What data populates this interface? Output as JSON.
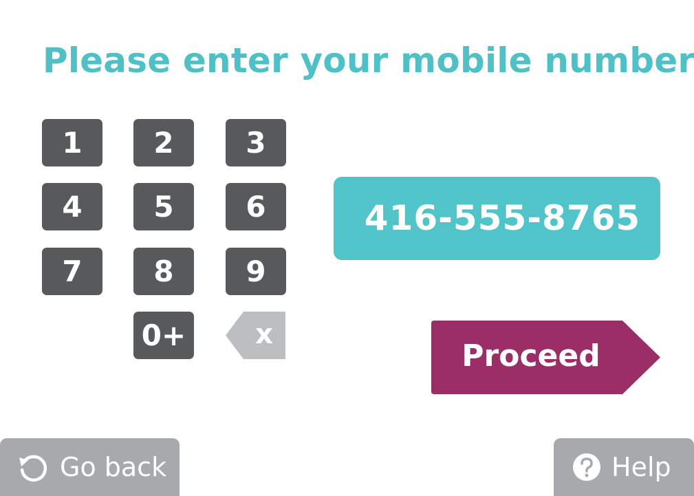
{
  "prompt": "Please enter your mobile number:",
  "keypad": {
    "keys": [
      "1",
      "2",
      "3",
      "4",
      "5",
      "6",
      "7",
      "8",
      "9",
      "0+"
    ],
    "backspace_label": "x"
  },
  "phone_display": {
    "value": "416-555-8765"
  },
  "proceed_button": {
    "label": "Proceed"
  },
  "footer": {
    "back_label": "Go back",
    "help_label": "Help"
  },
  "icons": {
    "back": "refresh-back-icon",
    "help": "question-circle-icon"
  },
  "colors": {
    "accent": "#4fc0c5",
    "key": "#58595b",
    "backspace": "#bcbec0",
    "proceed": "#9b2d67",
    "footer_button": "#a7a9ac"
  }
}
